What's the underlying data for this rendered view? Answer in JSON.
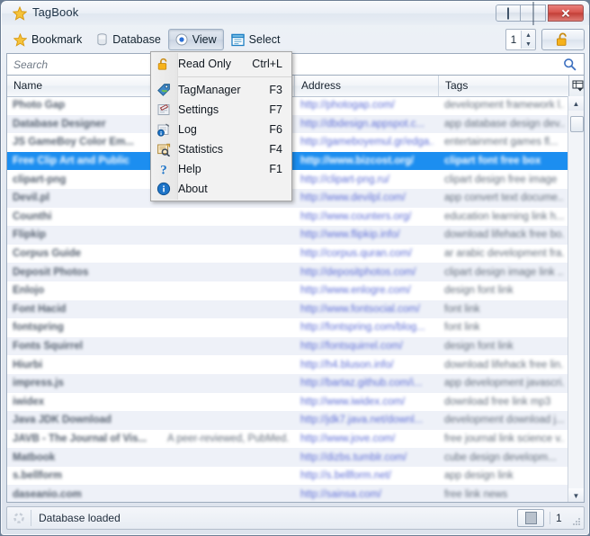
{
  "window": {
    "title": "TagBook",
    "title_icon": "star-icon",
    "buttons": {
      "minimize": "minimize-icon",
      "maximize": "maximize-icon",
      "close": "close-icon"
    }
  },
  "toolbar": {
    "items": [
      {
        "label": "Bookmark",
        "icon": "star-icon",
        "pressed": false
      },
      {
        "label": "Database",
        "icon": "database-icon",
        "pressed": false
      },
      {
        "label": "View",
        "icon": "radio-dot-icon",
        "pressed": true
      },
      {
        "label": "Select",
        "icon": "select-window-icon",
        "pressed": false
      }
    ],
    "spinner_value": "1",
    "lock_icon": "unlocked-padlock-icon"
  },
  "search": {
    "placeholder": "Search",
    "value": "",
    "icon": "search-magnifier-icon"
  },
  "menu": {
    "open_from": "View",
    "items": [
      {
        "label": "Read Only",
        "shortcut": "Ctrl+L",
        "icon": "unlocked-padlock-icon",
        "separator_after": true
      },
      {
        "label": "TagManager",
        "shortcut": "F3",
        "icon": "tag-icon",
        "separator_after": false
      },
      {
        "label": "Settings",
        "shortcut": "F7",
        "icon": "settings-pencil-icon",
        "separator_after": false
      },
      {
        "label": "Log",
        "shortcut": "F6",
        "icon": "log-info-icon",
        "separator_after": false
      },
      {
        "label": "Statistics",
        "shortcut": "F4",
        "icon": "statistics-magnifier-icon",
        "separator_after": false
      },
      {
        "label": "Help",
        "shortcut": "F1",
        "icon": "question-mark-icon",
        "separator_after": false
      },
      {
        "label": "About",
        "shortcut": "",
        "icon": "info-icon",
        "separator_after": false
      }
    ]
  },
  "table": {
    "columns": [
      "Name",
      "",
      "Address",
      "Tags"
    ],
    "column_selector_icon": "column-chooser-icon",
    "selected_row_index": 3,
    "rows": [
      {
        "name": "Photo Gap",
        "col1": "",
        "address": "http://photogap.com/",
        "tags": "development framework l..."
      },
      {
        "name": "Database Designer",
        "col1": "",
        "address": "http://dbdesign.appspot.c...",
        "tags": "app database design dev..."
      },
      {
        "name": "JS GameBoy Color Em...",
        "col1": "",
        "address": "http://gameboyemul.gr/edga...",
        "tags": "entertainment games fl..."
      },
      {
        "name": "Free Clip Art and Public",
        "col1": "",
        "address": "http://www.bizcost.org/",
        "tags": "clipart font free box"
      },
      {
        "name": "clipart-png",
        "col1": "",
        "address": "http://clipart-png.ru/",
        "tags": "clipart design free image"
      },
      {
        "name": "Devil.pl",
        "col1": "",
        "address": "http://www.devilpl.com/",
        "tags": "app convert text docume..."
      },
      {
        "name": "Counthi",
        "col1": "",
        "address": "http://www.counters.org/",
        "tags": "education learning link h..."
      },
      {
        "name": "Flipkip",
        "col1": "",
        "address": "http://www.flipkip.info/",
        "tags": "download lifehack free bo..."
      },
      {
        "name": "Corpus Guide",
        "col1": "",
        "address": "http://corpus.quran.com/",
        "tags": "ar arabic development fra..."
      },
      {
        "name": "Deposit Photos",
        "col1": "",
        "address": "http://depositphotos.com/",
        "tags": "clipart design image link ..."
      },
      {
        "name": "Enlojo",
        "col1": "",
        "address": "http://www.enlogre.com/",
        "tags": "design font link"
      },
      {
        "name": "Font Hacid",
        "col1": "",
        "address": "http://www.fontsocial.com/",
        "tags": "font link"
      },
      {
        "name": "fontspring",
        "col1": "",
        "address": "http://fontspring.com/blog...",
        "tags": "font link"
      },
      {
        "name": "Fonts Squirrel",
        "col1": "",
        "address": "http://fontsquirrel.com/",
        "tags": "design font link"
      },
      {
        "name": "Hiurbi",
        "col1": "",
        "address": "http://h4.bluson.info/",
        "tags": "download lifehack free lin..."
      },
      {
        "name": "impress.js",
        "col1": "",
        "address": "http://bartaz.github.com/i...",
        "tags": "app development javascri..."
      },
      {
        "name": "iwidex",
        "col1": "",
        "address": "http://www.iwidex.com/",
        "tags": "download free link mp3"
      },
      {
        "name": "Java JDK Download",
        "col1": "",
        "address": "http://jdk7.java.net/downl...",
        "tags": "development download j..."
      },
      {
        "name": "JAVB - The Journal of Vis...",
        "col1": "A peer-reviewed, PubMed...",
        "address": "http://www.jove.com/",
        "tags": "free journal link science v..."
      },
      {
        "name": "Matbook",
        "col1": "",
        "address": "http://dizbs.tumblr.com/",
        "tags": "cube design developm..."
      },
      {
        "name": "s.bellform",
        "col1": "",
        "address": "http://s.bellform.net/",
        "tags": "app design link"
      },
      {
        "name": "daseanio.com",
        "col1": "",
        "address": "http://sainsa.com/",
        "tags": "free link news"
      }
    ]
  },
  "status": {
    "icon": "busy-spinner-icon",
    "message": "Database loaded",
    "indicator_icon": "stop-square-icon",
    "count": "1"
  },
  "colors": {
    "selection": "#1c8ef0",
    "accent_star": "#f0b51e",
    "close_button": "#c33f38",
    "link_text": "#5f6fd6"
  }
}
